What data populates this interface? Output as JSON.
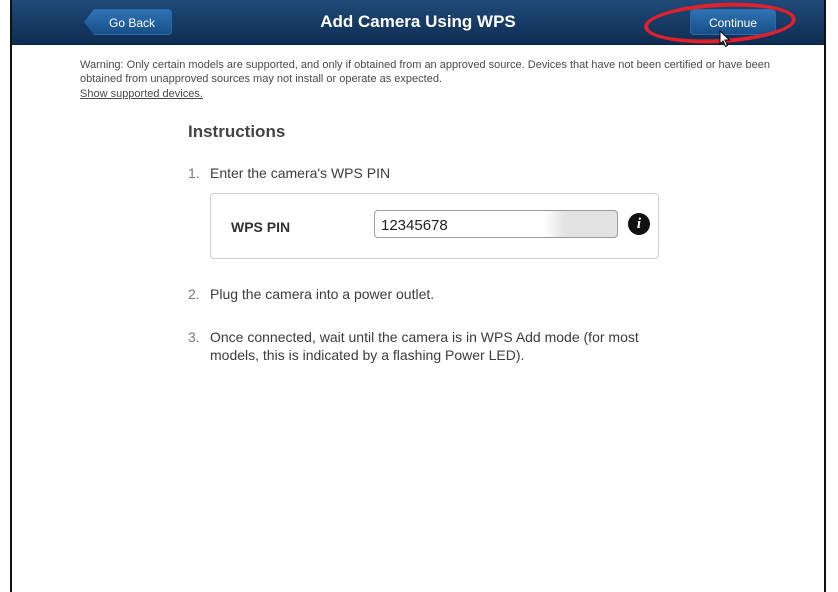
{
  "header": {
    "title": "Add Camera Using WPS",
    "back_label": "Go Back",
    "continue_label": "Continue"
  },
  "warning": {
    "text": "Warning: Only certain models are supported, and only if obtained from an approved source. Devices that have not been certified or have been obtained from unapproved sources may not install or operate as expected.",
    "link": "Show supported devices."
  },
  "instructions": {
    "title": "Instructions",
    "steps": [
      {
        "num": "1.",
        "text": "Enter the camera's WPS PIN"
      },
      {
        "num": "2.",
        "text": "Plug the camera into a power outlet."
      },
      {
        "num": "3.",
        "text": "Once connected, wait until the camera is in WPS Add mode (for most models, this is indicated by a flashing Power LED)."
      }
    ]
  },
  "pin": {
    "label": "WPS PIN",
    "value": "12345678",
    "info_icon": "info-icon"
  },
  "colors": {
    "header": "#163b66",
    "button": "#2568a8",
    "highlight": "#e0202a"
  }
}
